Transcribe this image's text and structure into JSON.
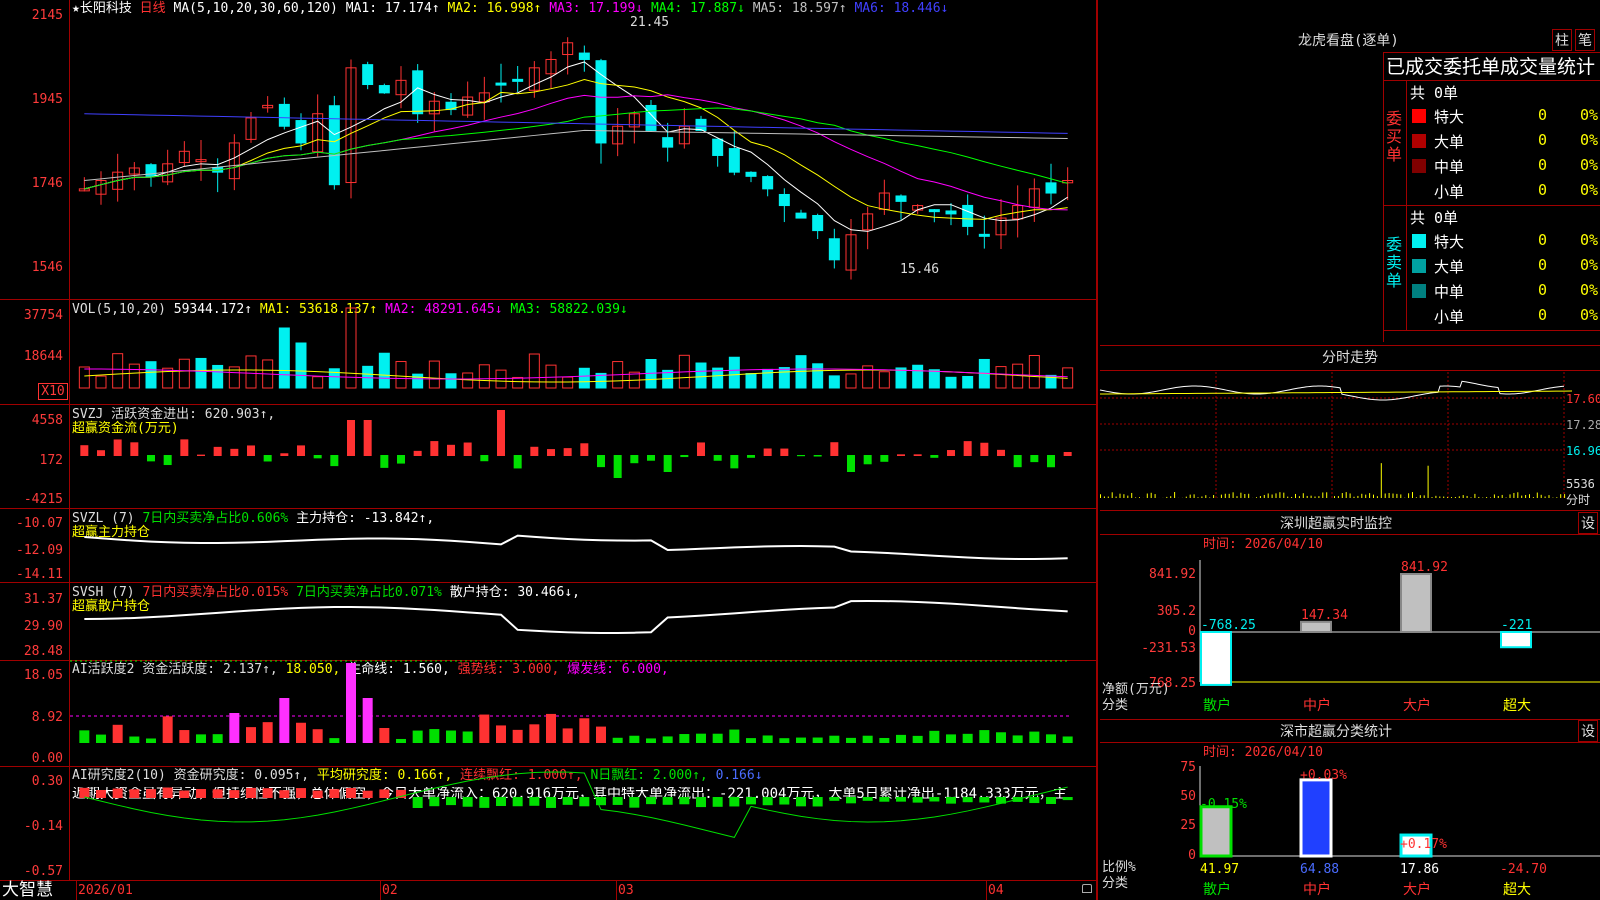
{
  "colors": {
    "up": "#ff3232",
    "down": "#00f0f0",
    "ma1": "#ffffff",
    "ma2": "#ffff00",
    "ma3": "#ff00ff",
    "ma4": "#00ff00",
    "ma5": "#c0c0c0",
    "ma6": "#4040ff",
    "grid": "#a00000",
    "green": "#00e000"
  },
  "main": {
    "star": "★",
    "stock": "长阳科技",
    "period": "日线",
    "ma_label": "MA(5,10,20,30,60,120)",
    "ma": [
      {
        "t": "MA1: 17.174↑"
      },
      {
        "t": "MA2: 16.998↑"
      },
      {
        "t": "MA3: 17.199↓"
      },
      {
        "t": "MA4: 17.887↓"
      },
      {
        "t": "MA5: 18.597↑"
      },
      {
        "t": "MA6: 18.446↓"
      }
    ],
    "ticks": [
      "2145",
      "1945",
      "1746",
      "1546"
    ],
    "high_label": "21.45",
    "low_label": "15.46"
  },
  "vol": {
    "label": "VOL(5,10,20)",
    "value": "59344.172↑",
    "ma1": "MA1: 53618.137↑",
    "ma2": "MA2: 48291.645↓",
    "ma3": "MA3: 58822.039↓",
    "ticks": [
      "37754",
      "18644"
    ],
    "unit": "X10"
  },
  "svzj": {
    "l1": "SVZJ  活跃资金进出: 620.903↑,",
    "l2": "超赢资金流(万元)",
    "ticks": [
      "4558",
      "172",
      "-4215"
    ]
  },
  "svzl": {
    "l1": "SVZL (7)",
    "l2": "7日内买卖净占比0.606%",
    "l3": "主力持仓: -13.842↑,",
    "l4": "超赢主力持仓",
    "ticks": [
      "-10.07",
      "-12.09",
      "-14.11"
    ]
  },
  "svsh": {
    "l1": "SVSH (7)",
    "l2": "7日内买卖净占比0.015%",
    "l3": "7日内买卖净占比0.071%",
    "l4": "散户持仓: 30.466↓,",
    "l5": "超赢散户持仓",
    "ticks": [
      "31.37",
      "29.90",
      "28.48"
    ]
  },
  "ai2": {
    "l1": "AI活跃度2 资金活跃度: 2.137↑,",
    "l2": "18.050,",
    "l3": "生命线: 1.560,",
    "l4": "强势线: 3.000,",
    "l5": "爆发线: 6.000,",
    "ticks": [
      "18.05",
      "8.92",
      "0.00"
    ]
  },
  "ai3": {
    "l1": "AI研究度2(10) 资金研究度: 0.095↑,",
    "l2": "平均研究度: 0.166↑,",
    "l3": "连续飘红: 1.000↑,",
    "l4": "N日飘红: 2.000↑,",
    "l5": "0.166↓",
    "note": "近期大资金虽有异动，但持续性不强，总体偏空，今日大单净流入：620.916万元，其中特大单净流出：-221.004万元，大单5日累计净出-1184.333万元，主",
    "ticks": [
      "0.30",
      "-0.14",
      "-0.57"
    ]
  },
  "xaxis": {
    "brand": "大智慧",
    "labels": [
      "2026/01",
      "02",
      "03",
      "04"
    ]
  },
  "lhb": {
    "title": "龙虎看盘(逐单)",
    "btn1": "柱",
    "btn2": "笔",
    "subtitle": "已成交委托单成交量统计",
    "buy": {
      "side": "委买单",
      "count": "共 0单",
      "rows": [
        {
          "name": "特大",
          "v": "0",
          "p": "0%"
        },
        {
          "name": "大单",
          "v": "0",
          "p": "0%"
        },
        {
          "name": "中单",
          "v": "0",
          "p": "0%"
        },
        {
          "name": "小单",
          "v": "0",
          "p": "0%"
        }
      ]
    },
    "sell": {
      "side": "委卖单",
      "count": "共 0单",
      "rows": [
        {
          "name": "特大",
          "v": "0",
          "p": "0%"
        },
        {
          "name": "大单",
          "v": "0",
          "p": "0%"
        },
        {
          "name": "中单",
          "v": "0",
          "p": "0%"
        },
        {
          "name": "小单",
          "v": "0",
          "p": "0%"
        }
      ]
    }
  },
  "fenshi": {
    "title": "分时走势",
    "ticks": [
      "17.60",
      "17.28",
      "16.96",
      "5536",
      "分时"
    ]
  },
  "monitor": {
    "title": "深圳超赢实时监控",
    "btn": "设",
    "time": "时间: 2026/04/10",
    "ticks": [
      "841.92",
      "305.2",
      "0",
      "-231.53",
      "-768.25"
    ],
    "ylabel": "净额(万元)",
    "xlabel": "分类",
    "cats": [
      "散户",
      "中户",
      "大户",
      "超大"
    ],
    "values": [
      "-768.25",
      "147.34",
      "841.92",
      "-221"
    ]
  },
  "classify": {
    "title": "深市超赢分类统计",
    "btn": "设",
    "time": "时间: 2026/04/10",
    "ticks": [
      "75",
      "50",
      "25",
      "0"
    ],
    "ylabel": "比例%",
    "xlabel": "分类",
    "cats": [
      "散户",
      "中户",
      "大户",
      "超大"
    ],
    "pct": [
      "-0.15%",
      "+0.03%",
      "+0.17%"
    ],
    "values": [
      "41.97",
      "64.88",
      "17.86",
      "-24.70"
    ]
  }
}
